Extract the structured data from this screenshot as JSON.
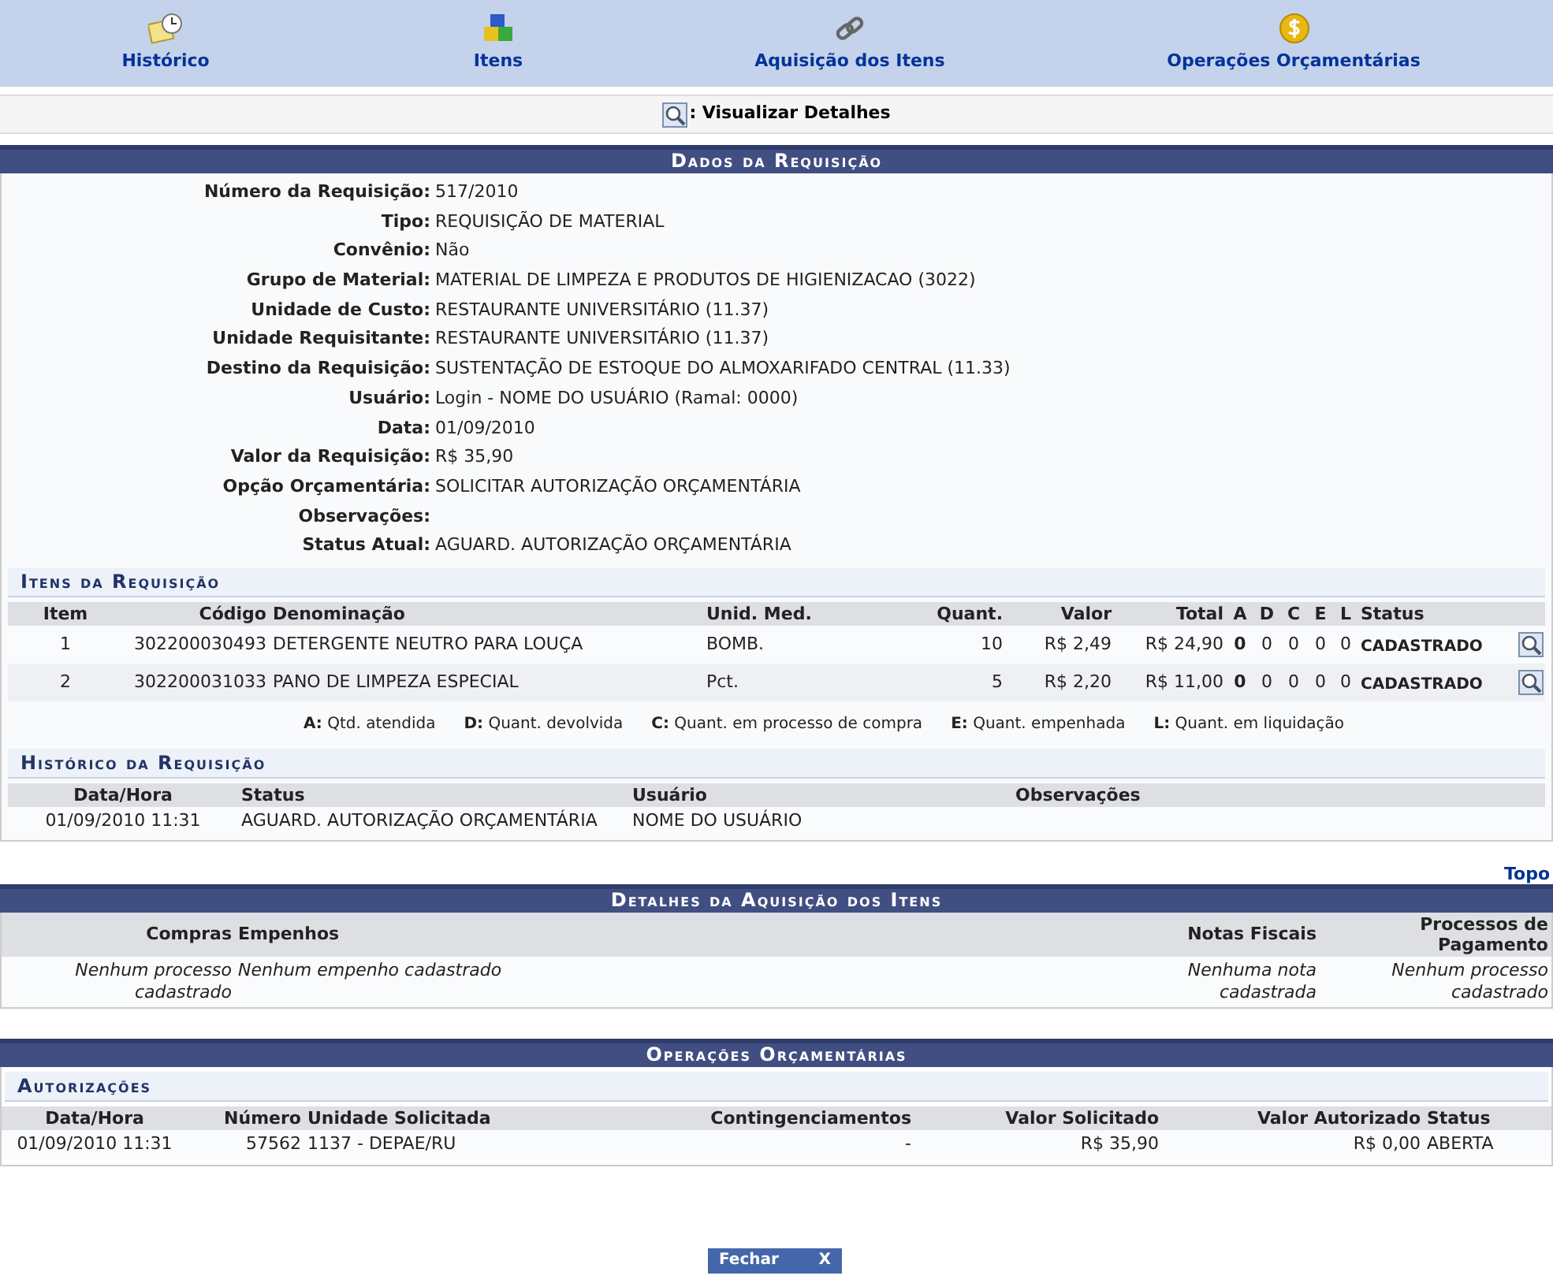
{
  "nav": [
    {
      "label": "Histórico",
      "kind": "clock"
    },
    {
      "label": "Itens",
      "kind": "cubes"
    },
    {
      "label": "Aquisição dos Itens",
      "kind": "chain"
    },
    {
      "label": "Operações Orçamentárias",
      "kind": "coin"
    }
  ],
  "legend": {
    "label": ": Visualizar Detalhes"
  },
  "dados": {
    "title": "Dados da Requisição",
    "fields": [
      {
        "label": "Número da Requisição:",
        "value": "517/2010"
      },
      {
        "label": "Tipo:",
        "value": "REQUISIÇÃO DE MATERIAL"
      },
      {
        "label": "Convênio:",
        "value": "Não"
      },
      {
        "label": "Grupo de Material:",
        "value": "MATERIAL DE LIMPEZA E PRODUTOS DE HIGIENIZACAO (3022)"
      },
      {
        "label": "Unidade de Custo:",
        "value": "RESTAURANTE UNIVERSITÁRIO (11.37)"
      },
      {
        "label": "Unidade Requisitante:",
        "value": "RESTAURANTE UNIVERSITÁRIO (11.37)"
      },
      {
        "label": "Destino da Requisição:",
        "value": "SUSTENTAÇÃO DE ESTOQUE DO ALMOXARIFADO CENTRAL (11.33)"
      },
      {
        "label": "Usuário:",
        "value": "Login - NOME DO USUÁRIO (Ramal: 0000)"
      },
      {
        "label": "Data:",
        "value": "01/09/2010"
      },
      {
        "label": "Valor da Requisição:",
        "value": "R$ 35,90"
      },
      {
        "label": "Opção Orçamentária:",
        "value": "SOLICITAR AUTORIZAÇÃO ORÇAMENTÁRIA"
      },
      {
        "label": "Observações:"
      },
      {
        "label": "Status Atual:",
        "value": "AGUARD. AUTORIZAÇÃO ORÇAMENTÁRIA"
      }
    ],
    "itens": {
      "title": "Itens da Requisição",
      "columns": [
        "Item",
        "Código",
        "Denominação",
        "Unid. Med.",
        "Quant.",
        "Valor",
        "Total",
        "A",
        "D",
        "C",
        "E",
        "L",
        "Status"
      ],
      "rows": [
        [
          "1",
          "302200030493",
          "DETERGENTE NEUTRO PARA LOUÇA",
          "BOMB.",
          "10",
          "R$ 2,49",
          "R$ 24,90",
          "0",
          "0",
          "0",
          "0",
          "0",
          "CADASTRADO"
        ],
        [
          "2",
          "302200031033",
          "PANO DE LIMPEZA ESPECIAL",
          "Pct.",
          "5",
          "R$ 2,20",
          "R$ 11,00",
          "0",
          "0",
          "0",
          "0",
          "0",
          "CADASTRADO"
        ]
      ],
      "legend": [
        {
          "key": "A:",
          "text": "Qtd. atendida"
        },
        {
          "key": "D:",
          "text": "Quant. devolvida"
        },
        {
          "key": "C:",
          "text": "Quant. em processo de compra"
        },
        {
          "key": "E:",
          "text": "Quant. empenhada"
        },
        {
          "key": "L:",
          "text": "Quant. em liquidação"
        }
      ]
    },
    "historico": {
      "title": "Histórico da Requisição",
      "columns": [
        "Data/Hora",
        "Status",
        "Usuário",
        "Observações"
      ],
      "rows": [
        [
          "01/09/2010 11:31",
          "AGUARD. AUTORIZAÇÃO ORÇAMENTÁRIA",
          "NOME DO USUÁRIO",
          ""
        ]
      ]
    }
  },
  "topo_link": "Topo",
  "aquisicao": {
    "title": "Detalhes da Aquisição dos Itens",
    "columns": [
      "Compras",
      "Empenhos",
      "Notas Fiscais",
      "Processos de Pagamento"
    ],
    "rows": [
      [
        "Nenhum processo cadastrado",
        "Nenhum empenho cadastrado",
        "Nenhuma nota cadastrada",
        "Nenhum processo cadastrado"
      ]
    ]
  },
  "orcamentarias": {
    "title": "Operações Orçamentárias",
    "subtitle": "Autorizações",
    "columns": [
      "Data/Hora",
      "Número",
      "Unidade Solicitada",
      "Contingenciamentos",
      "Valor Solicitado",
      "Valor Autorizado",
      "Status"
    ],
    "rows": [
      [
        "01/09/2010 11:31",
        "57562",
        "1137 - DEPAE/RU",
        "-",
        "R$ 35,90",
        "R$ 0,00",
        "ABERTA"
      ]
    ]
  },
  "close_button": {
    "label": "Fechar",
    "mark": "X"
  }
}
